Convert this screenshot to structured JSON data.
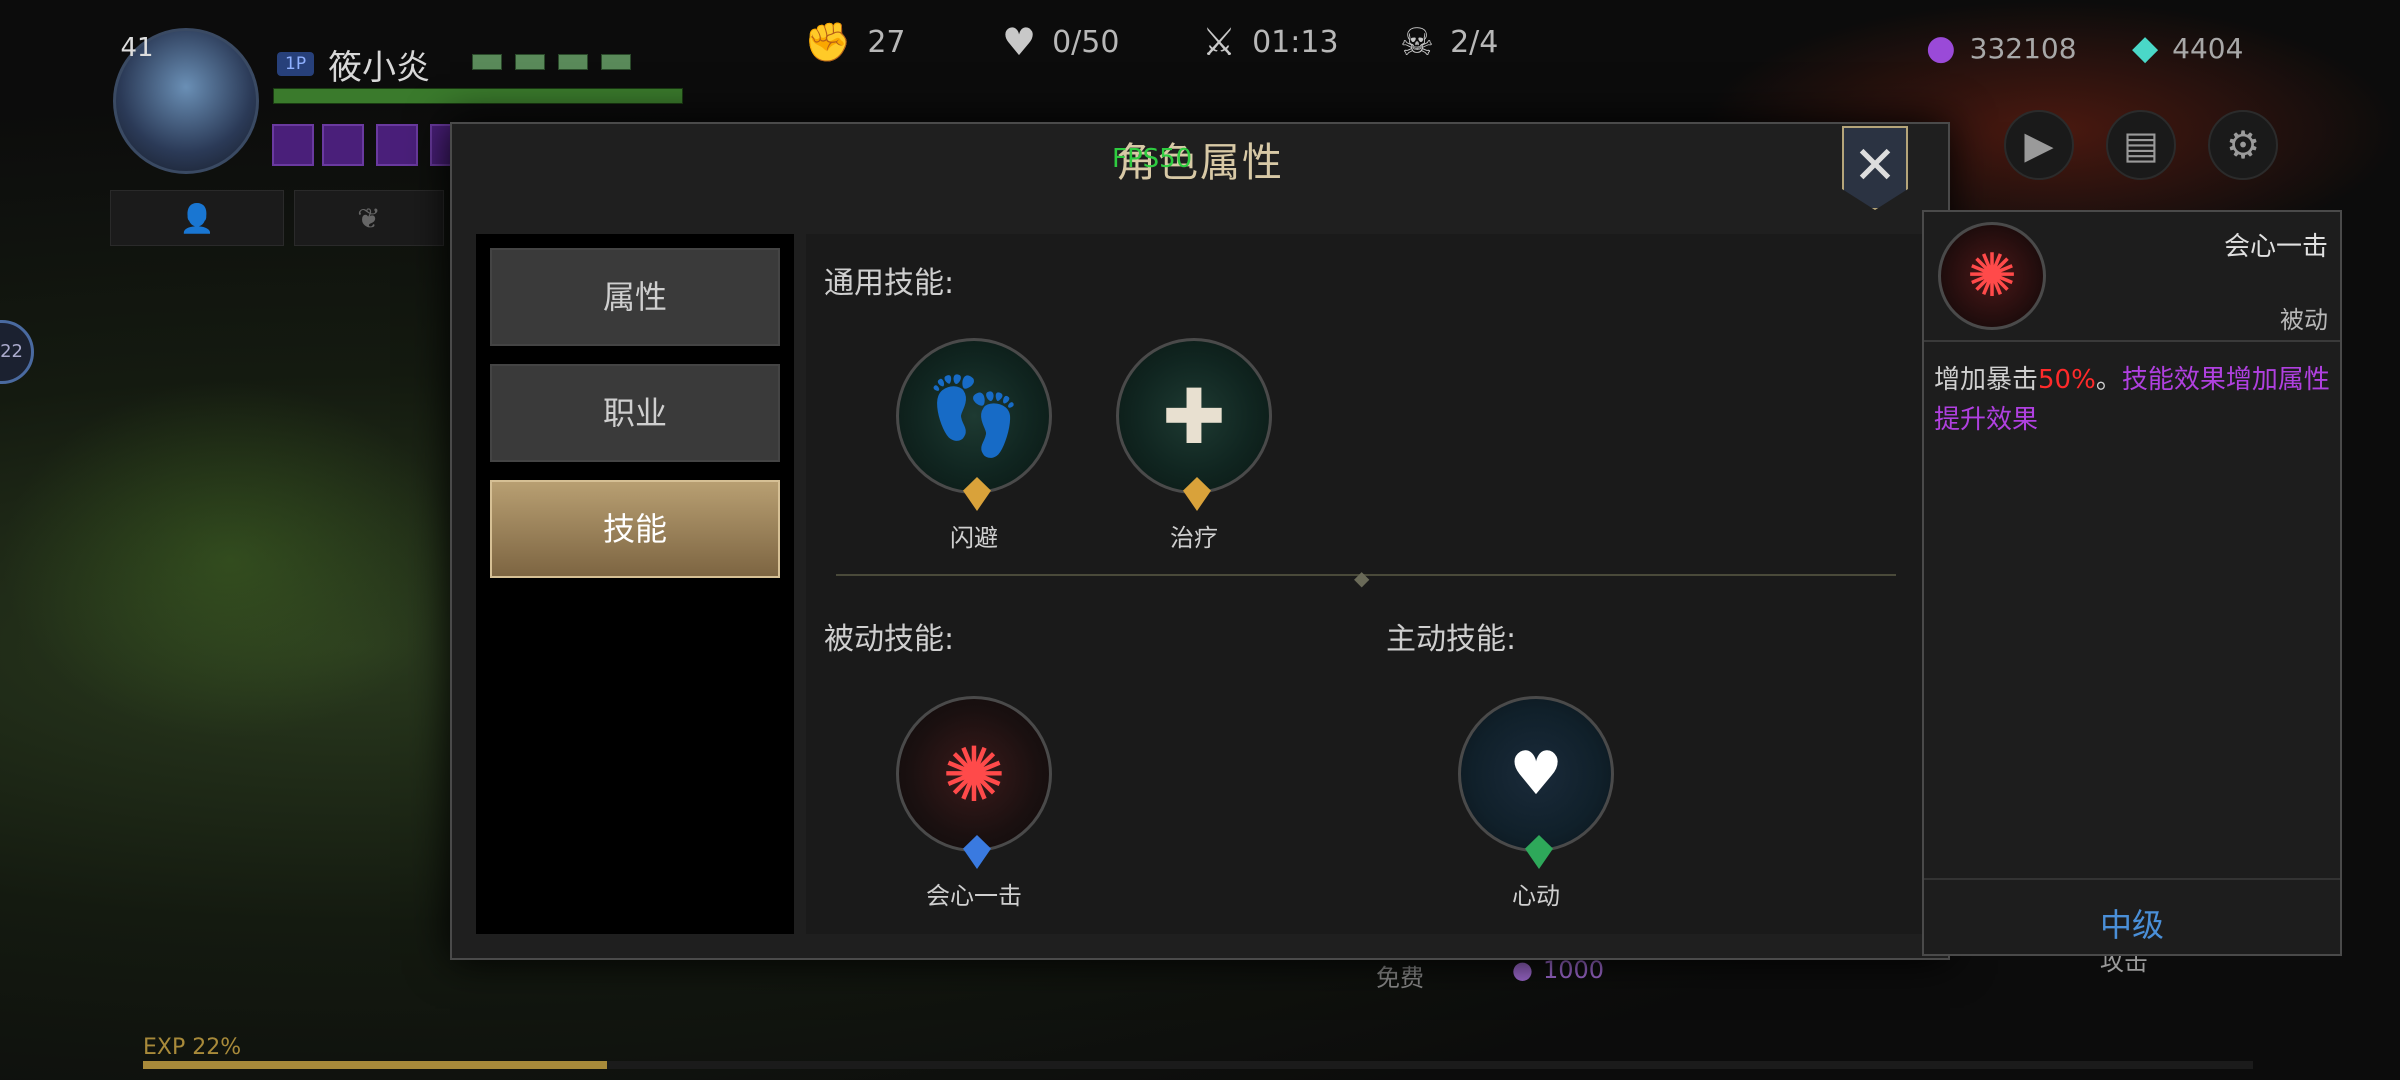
{
  "hud": {
    "level": "41",
    "player_tag": "1P",
    "player_name": "筱小炎",
    "stats": {
      "attack": "27",
      "heart": "0/50",
      "timer": "01:13",
      "kills": "2/4"
    },
    "currencies": {
      "purple_gems": "332108",
      "crystals": "4404"
    },
    "left_badge": "22",
    "exp_label": "EXP 22%",
    "exp_progress": 0.22,
    "free_label": "免费",
    "cost_value": "1000",
    "attack_hint": "攻击"
  },
  "dialog": {
    "title": "角色属性",
    "fps": "FPS50",
    "close_symbol": "✕",
    "nav": [
      {
        "label": "属性",
        "active": false
      },
      {
        "label": "职业",
        "active": false
      },
      {
        "label": "技能",
        "active": true
      }
    ],
    "general_title": "通用技能:",
    "passive_title": "被动技能:",
    "active_title": "主动技能:",
    "general_skills": [
      {
        "name": "闪避",
        "icon": "foot-icon",
        "gem": "#d9a23a"
      },
      {
        "name": "治疗",
        "icon": "heal-heart-icon",
        "gem": "#d9a23a"
      }
    ],
    "passive_skills": [
      {
        "name": "会心一击",
        "icon": "crit-slash-icon",
        "gem": "#3a7ae0"
      }
    ],
    "active_skills": [
      {
        "name": "心动",
        "icon": "sparkle-heart-icon",
        "gem": "#2ea85a"
      }
    ]
  },
  "tooltip": {
    "name": "会心一击",
    "type": "被动",
    "desc_prefix": "增加暴击",
    "desc_value": "50%",
    "desc_sep": "。",
    "desc_suffix": "技能效果增加属性提升效果",
    "grade": "中级",
    "colors": {
      "value": "#ff2a2a",
      "suffix": "#b040e0",
      "grade": "#4a8fd8"
    }
  }
}
